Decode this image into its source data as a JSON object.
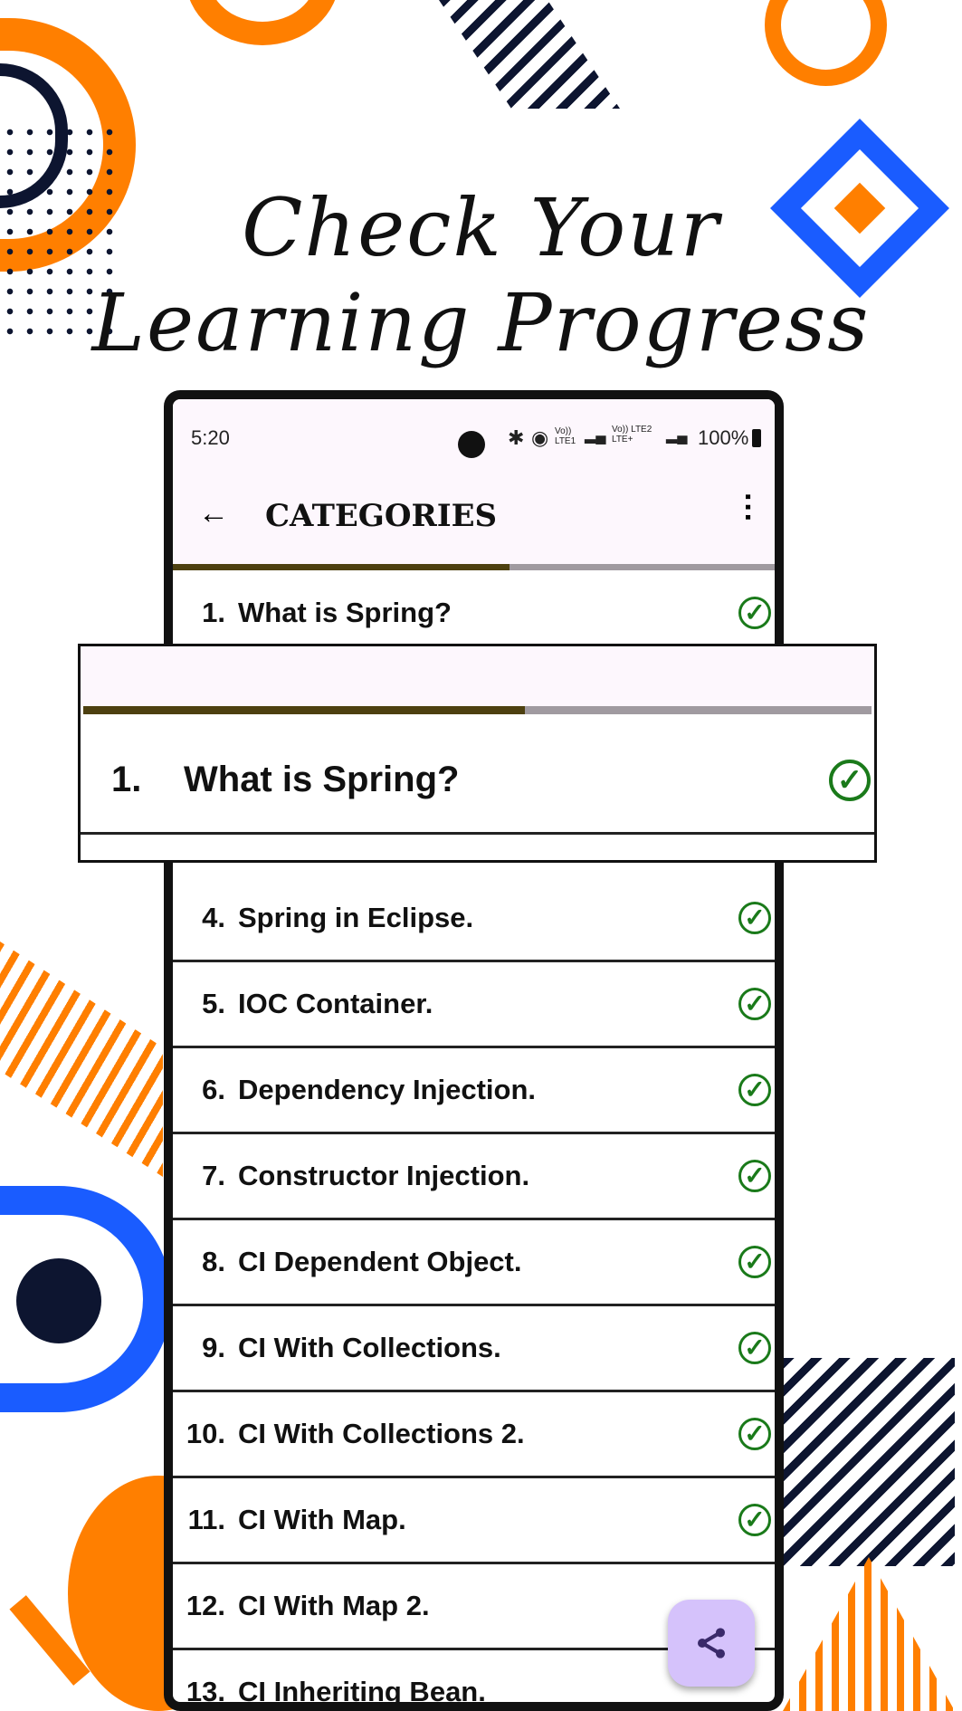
{
  "headline": {
    "line1": "Check Your",
    "line2": "Learning Progress"
  },
  "status_bar": {
    "time": "5:20",
    "icons": [
      "bluetooth-icon",
      "hotspot-icon",
      "volte-lte1-icon",
      "signal-icon",
      "volte-lte2-icon",
      "signal-icon"
    ],
    "lte1": "Vo)) LTE1",
    "lte2": "Vo)) LTE2 LTE+",
    "battery": "100%"
  },
  "toolbar": {
    "title": "CATEGORIES",
    "back_icon": "arrow-left-icon",
    "menu_icon": "more-vert-icon"
  },
  "progress": {
    "fraction": 0.56,
    "fill_color": "#4d4010",
    "track_color": "#a09aa0"
  },
  "magnified": {
    "progress_fraction": 0.56,
    "item": {
      "num": "1.",
      "title": "What is Spring?",
      "done": true
    }
  },
  "items": [
    {
      "num": "1.",
      "title": "What is Spring?",
      "done": true
    },
    {
      "num": "4.",
      "title": "Spring in Eclipse.",
      "done": true
    },
    {
      "num": "5.",
      "title": "IOC Container.",
      "done": true
    },
    {
      "num": "6.",
      "title": "Dependency Injection.",
      "done": true
    },
    {
      "num": "7.",
      "title": "Constructor Injection.",
      "done": true
    },
    {
      "num": "8.",
      "title": "CI Dependent Object.",
      "done": true
    },
    {
      "num": "9.",
      "title": "CI With Collections.",
      "done": true
    },
    {
      "num": "10.",
      "title": "CI With Collections 2.",
      "done": true
    },
    {
      "num": "11.",
      "title": "CI With Map.",
      "done": true
    },
    {
      "num": "12.",
      "title": "CI With Map 2.",
      "done": false
    },
    {
      "num": "13.",
      "title": "CI Inheriting Bean.",
      "done": false
    }
  ],
  "fab": {
    "icon": "share-icon",
    "color": "#d5c2fb"
  },
  "colors": {
    "orange": "#ff7f00",
    "navy": "#0d1530",
    "blue": "#1a5cff",
    "check_green": "#1a7a1a"
  }
}
